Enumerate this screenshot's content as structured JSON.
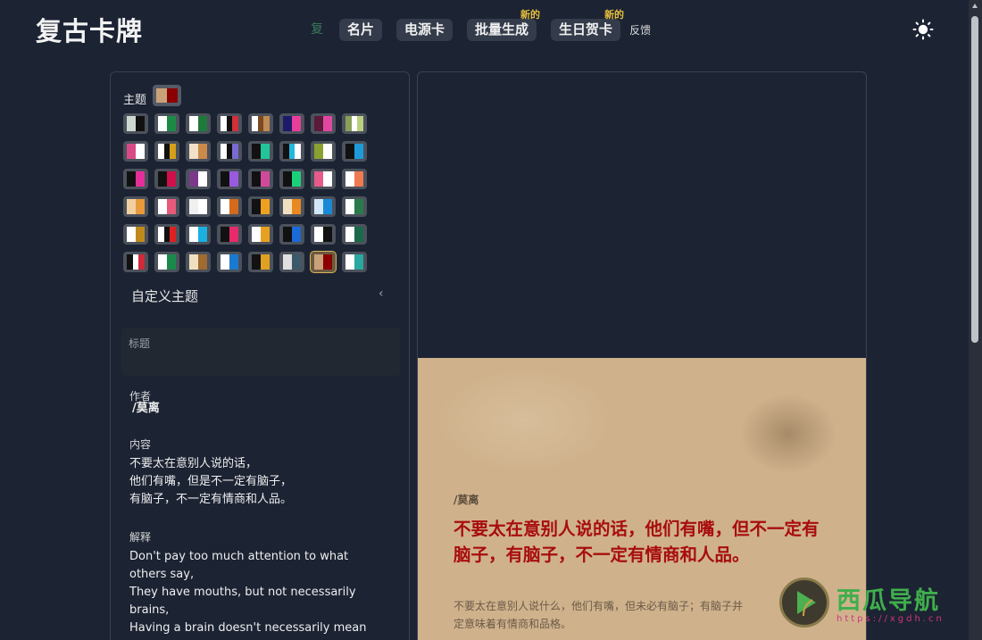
{
  "app": {
    "title": "复古卡牌"
  },
  "nav": {
    "items": [
      {
        "label": "复",
        "active": true
      },
      {
        "label": "名片"
      },
      {
        "label": "电源卡"
      },
      {
        "label": "批量生成",
        "badge": "新的"
      },
      {
        "label": "生日贺卡",
        "badge": "新的"
      }
    ],
    "feedback": "反馈"
  },
  "sidebar": {
    "theme_label": "主题",
    "current_theme_colors": [
      "#c9a27a",
      "#8b0000"
    ],
    "themes": [
      [
        "#cfd8cf",
        "#111111"
      ],
      [
        "#ffffff",
        "#1c8a45"
      ],
      [
        "#ffffff",
        "#1f7a3a"
      ],
      [
        "#ffffff",
        "#111111",
        "#d22f3b"
      ],
      [
        "#ffffff",
        "#7b4a22",
        "#c08a55"
      ],
      [
        "#1b1b6a",
        "#e83e9a"
      ],
      [
        "#5a1a3a",
        "#e048a0"
      ],
      [
        "#8aa05a",
        "#ffffff",
        "#b8d080"
      ],
      [
        "#d84a86",
        "#ffffff"
      ],
      [
        "#ffffff",
        "#111111",
        "#d4a017"
      ],
      [
        "#f2e0c8",
        "#c98a4a"
      ],
      [
        "#ffffff",
        "#111111",
        "#7a6ad0"
      ],
      [
        "#111111",
        "#22c59a"
      ],
      [
        "#111111",
        "#22b8e0",
        "#ffffff"
      ],
      [
        "#8aa030",
        "#ffffff"
      ],
      [
        "#111111",
        "#1e9ad8"
      ],
      [
        "#111111",
        "#e62e9a"
      ],
      [
        "#111111",
        "#d0104a"
      ],
      [
        "#7a3a8a",
        "#ffffff"
      ],
      [
        "#111111",
        "#9a5ae0"
      ],
      [
        "#111111",
        "#d04a9a"
      ],
      [
        "#111111",
        "#1ad07a"
      ],
      [
        "#e85a8a",
        "#ffffff"
      ],
      [
        "#ffffff",
        "#f07a50"
      ],
      [
        "#f0d0a0",
        "#e89a3a"
      ],
      [
        "#ffffff",
        "#e85a7a"
      ],
      [
        "#f0f0f0",
        "#ffffff"
      ],
      [
        "#ffffff",
        "#d46a1a"
      ],
      [
        "#111111",
        "#f0a020"
      ],
      [
        "#f0e0c0",
        "#e88a20"
      ],
      [
        "#d0e8f8",
        "#1a8ad8"
      ],
      [
        "#ffffff",
        "#2a7a4a"
      ],
      [
        "#ffffff",
        "#c08a1a"
      ],
      [
        "#ffffff",
        "#111111",
        "#e02020"
      ],
      [
        "#ffffff",
        "#1ab0e0"
      ],
      [
        "#111111",
        "#e82a6a"
      ],
      [
        "#ffffff",
        "#e8a020"
      ],
      [
        "#111111",
        "#1a6ad8"
      ],
      [
        "#ffffff",
        "#111111"
      ],
      [
        "#ffffff",
        "#1a6a4a"
      ],
      [
        "#111111",
        "#ffffff",
        "#d02a3a"
      ],
      [
        "#ffffff",
        "#1a8a4a"
      ],
      [
        "#f0e0c0",
        "#a06a30"
      ],
      [
        "#ffffff",
        "#1a7ad0"
      ],
      [
        "#111111",
        "#e0a020"
      ],
      [
        "#e0e0e0",
        "#3a5a6a"
      ],
      [
        "#c9a27a",
        "#8b0000"
      ],
      [
        "#ffffff",
        "#2aa8a0"
      ]
    ],
    "selected_theme_index": 46,
    "custom_theme_label": "自定义主题",
    "title_field": {
      "label": "标题",
      "value": ""
    },
    "author_field": {
      "label": "作者",
      "value": "/莫离"
    },
    "content_field": {
      "label": "内容",
      "lines": [
        "不要太在意别人说的话，",
        "他们有嘴，但是不一定有脑子，",
        "有脑子，不一定有情商和人品。"
      ]
    },
    "explanation_field": {
      "label": "解释",
      "lines": [
        "Don't pay too much attention to what",
        "others say,",
        "They have mouths, but not necessarily",
        "brains,",
        "Having a brain doesn't necessarily mean"
      ]
    }
  },
  "card": {
    "author": "/莫离",
    "text": "不要太在意别人说的话，他们有嘴，但不一定有脑子，有脑子，不一定有情商和人品。",
    "note_lines": [
      "不要太在意别人说什么，他们有嘴，但未必有脑子；有脑子并",
      "定意味着有情商和品格。"
    ]
  },
  "watermark": {
    "title": "西瓜导航",
    "url": "https://xgdh.cn"
  }
}
